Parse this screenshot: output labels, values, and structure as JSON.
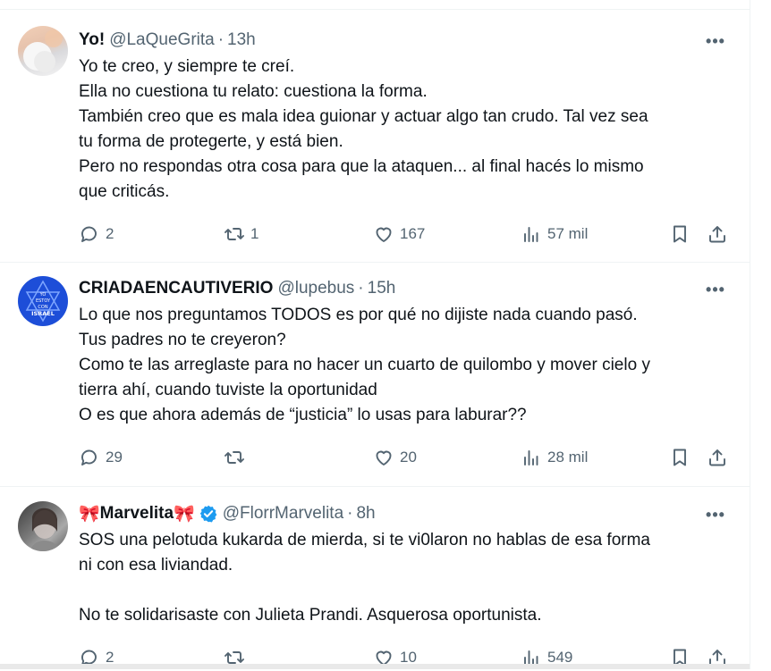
{
  "tweets": [
    {
      "name": "Yo!",
      "name_emoji": "",
      "verified": false,
      "handle": "@LaQueGrita",
      "time": "13h",
      "lines": [
        "Yo te creo, y siempre te creí.",
        "Ella no cuestiona tu relato: cuestiona la forma.",
        "También creo que es mala idea guionar y actuar algo tan crudo. Tal vez sea",
        "tu forma de protegerte, y está bien.",
        "Pero no respondas otra cosa para que la ataquen... al final hacés lo mismo",
        "que criticás."
      ],
      "replies": "2",
      "retweets": "1",
      "likes": "167",
      "views": "57 mil"
    },
    {
      "name": "CRIADAENCAUTIVERIO",
      "name_emoji": "",
      "verified": false,
      "handle": "@lupebus",
      "time": "15h",
      "avatar_text": [
        "YO",
        "ESTOY",
        "CON",
        "ISRAEL"
      ],
      "lines": [
        "Lo que nos preguntamos TODOS es por qué no dijiste nada cuando pasó.",
        "Tus padres no te creyeron?",
        "Como te las arreglaste para no hacer un cuarto de quilombo y mover cielo y",
        "tierra ahí, cuando tuviste la oportunidad",
        "O es que ahora además de “justicia” lo usas para laburar??"
      ],
      "replies": "29",
      "retweets": "",
      "likes": "20",
      "views": "28 mil"
    },
    {
      "name": "Marvelita",
      "name_emoji": "🎀",
      "verified": true,
      "handle": "@FlorrMarvelita",
      "time": "8h",
      "lines": [
        "SOS una pelotuda kukarda de mierda, si te vi0laron no hablas de esa forma",
        "ni con esa liviandad.",
        "",
        "No te solidarisaste con Julieta Prandi. Asquerosa oportunista."
      ],
      "replies": "2",
      "retweets": "",
      "likes": "10",
      "views": "549"
    }
  ],
  "separator": "·",
  "more_glyph": "•••",
  "colors": {
    "text": "#0f1419",
    "muted": "#536471",
    "verified": "#1d9bf0",
    "avatar2": "#1d4ed8"
  }
}
